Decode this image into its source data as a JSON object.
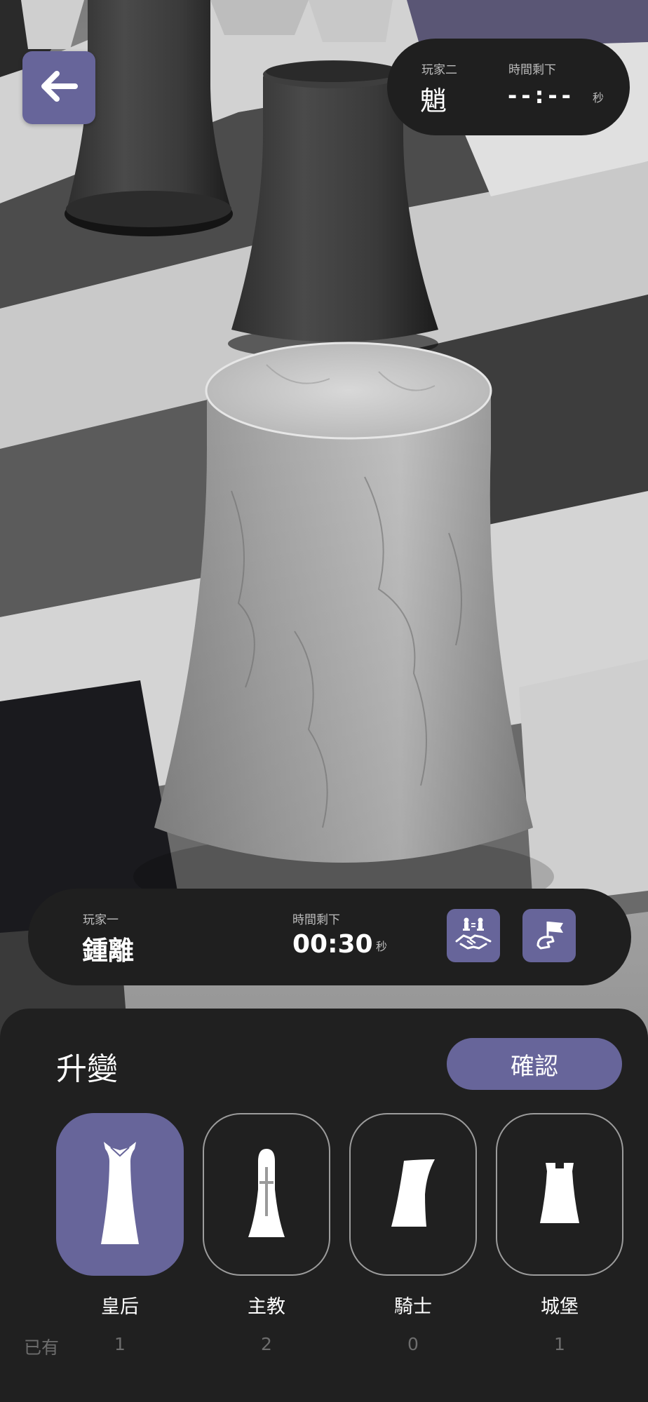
{
  "player_two": {
    "label": "玩家二",
    "name": "魈",
    "time_label": "時間剩下",
    "time": "--:--",
    "unit": "秒"
  },
  "player_one": {
    "label": "玩家一",
    "name": "鍾離",
    "time_label": "時間剩下",
    "time": "00:30",
    "unit": "秒"
  },
  "icons": {
    "back": "arrow-left-icon",
    "draw": "handshake-draw-icon",
    "resign": "white-flag-icon"
  },
  "promotion": {
    "title": "升變",
    "confirm_label": "確認",
    "owned_label": "已有",
    "pieces": [
      {
        "name": "皇后",
        "owned": "1",
        "icon": "queen-icon",
        "selected": true
      },
      {
        "name": "主教",
        "owned": "2",
        "icon": "bishop-icon",
        "selected": false
      },
      {
        "name": "騎士",
        "owned": "0",
        "icon": "knight-icon",
        "selected": false
      },
      {
        "name": "城堡",
        "owned": "1",
        "icon": "rook-icon",
        "selected": false
      }
    ]
  },
  "colors": {
    "accent": "#67659a",
    "panel": "#1f1f1f",
    "sheet": "#202020"
  }
}
